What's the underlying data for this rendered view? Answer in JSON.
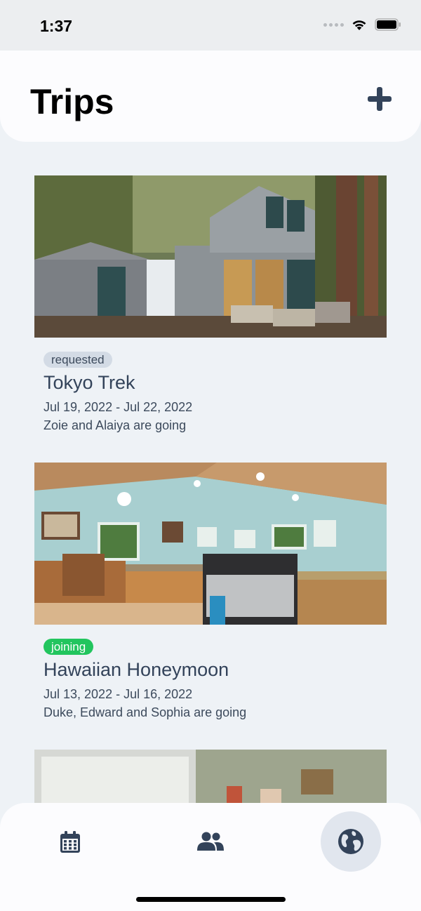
{
  "status_bar": {
    "time": "1:37",
    "icons": [
      "cellular-dots-icon",
      "wifi-icon",
      "battery-icon"
    ]
  },
  "header": {
    "title": "Trips",
    "add_icon": "plus-icon"
  },
  "trips": [
    {
      "status": "requested",
      "name": "Tokyo Trek",
      "dates": "Jul 19, 2022 - Jul 22, 2022",
      "people": "Zoie and Alaiya are going"
    },
    {
      "status": "joining",
      "name": "Hawaiian Honeymoon",
      "dates": "Jul 13, 2022 - Jul 16, 2022",
      "people": "Duke, Edward and Sophia are going"
    }
  ],
  "tab_bar": {
    "tabs": [
      {
        "icon": "calendar-icon",
        "active": false
      },
      {
        "icon": "people-icon",
        "active": false
      },
      {
        "icon": "globe-icon",
        "active": true
      }
    ]
  },
  "colors": {
    "background": "#eef2f6",
    "badge_requested": "#d3dbe5",
    "badge_joining": "#22c55e",
    "icon": "#33435a"
  }
}
